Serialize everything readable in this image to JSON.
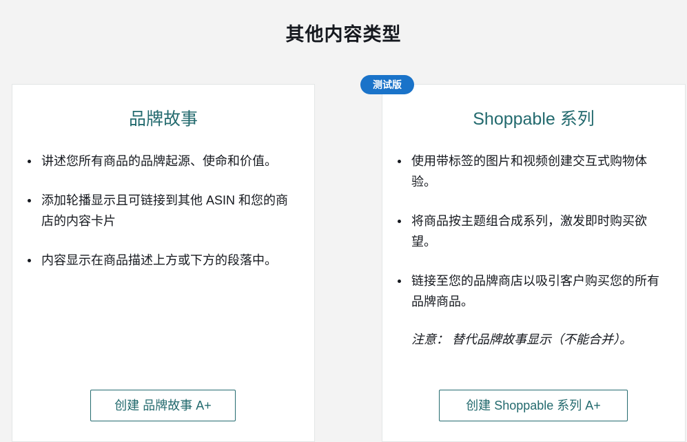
{
  "page": {
    "title": "其他内容类型"
  },
  "cards": [
    {
      "title": "品牌故事",
      "bullets": [
        "讲述您所有商品的品牌起源、使命和价值。",
        "添加轮播显示且可链接到其他 ASIN 和您的商店的内容卡片",
        "内容显示在商品描述上方或下方的段落中。"
      ],
      "button_label": "创建 品牌故事 A+"
    },
    {
      "badge": "测试版",
      "title": "Shoppable 系列",
      "bullets": [
        "使用带标签的图片和视频创建交互式购物体验。",
        "将商品按主题组合成系列，激发即时购买欲望。",
        "链接至您的品牌商店以吸引客户购买您的所有品牌商品。"
      ],
      "note": "注意： 替代品牌故事显示（不能合并）。",
      "button_label": "创建 Shoppable 系列 A+"
    }
  ],
  "colors": {
    "accent": "#236a6e",
    "badge": "#1a73c9",
    "background": "#f3f3f3"
  }
}
